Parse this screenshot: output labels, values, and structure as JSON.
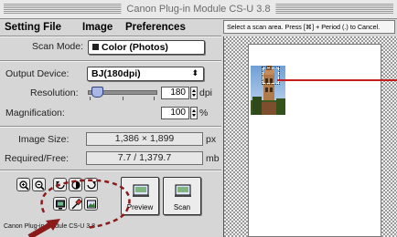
{
  "window": {
    "title": "Canon Plug-in Module CS-U 3.8"
  },
  "menu": {
    "items": [
      "Setting File",
      "Image",
      "Preferences"
    ]
  },
  "instructions": "Select a scan area. Press [⌘] + Period (.) to Cancel.",
  "scan_mode": {
    "label": "Scan Mode:",
    "value": "Color (Photos)"
  },
  "output_device": {
    "label": "Output Device:",
    "value": "BJ(180dpi)"
  },
  "resolution": {
    "label": "Resolution:",
    "value": "180",
    "unit": "dpi",
    "slider_fraction": 0.1
  },
  "magnification": {
    "label": "Magnification:",
    "value": "100",
    "unit": "%"
  },
  "image_size": {
    "label": "Image Size:",
    "value": "1,386 × 1,899",
    "unit": "px"
  },
  "required_free": {
    "label": "Required/Free:",
    "value": "7.7 / 1,379.7",
    "unit": "mb"
  },
  "buttons": {
    "preview": "Preview",
    "scan": "Scan"
  },
  "footer": "Canon Plug-in Module CS-U 3.8",
  "colors": {
    "selection_line": "#c81d1d",
    "annotation": "#8b1a1a",
    "slider_thumb": "#a9b6e8"
  }
}
